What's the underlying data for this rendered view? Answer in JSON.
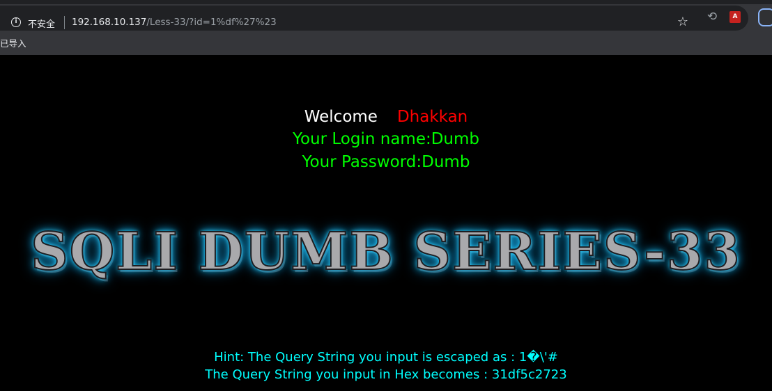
{
  "browser": {
    "security_label": "不安全",
    "url_host": "192.168.10.137",
    "url_path": "/Less-33/?id=1%df%27%23",
    "bookmark_label": "已导入",
    "icons": [
      "info-icon",
      "star-icon",
      "history-icon",
      "pdf-icon",
      "extension-icon"
    ]
  },
  "page": {
    "welcome_label": "Welcome",
    "welcome_name": "Dhakkan",
    "login_name": "Your Login name:Dumb",
    "password": "Your Password:Dumb",
    "banner_title": "SQLI DUMB SERIES-33",
    "hint_escaped": "Hint: The Query String you input is escaped as : 1�\\'#",
    "hint_hex": "The Query String you input in Hex becomes : 31df5c2723"
  },
  "colors": {
    "background": "#000000",
    "welcome": "#ffffff",
    "name": "#ff0000",
    "credentials": "#00ff00",
    "hint": "#00ffff",
    "banner_glow": "#33d6ff"
  }
}
